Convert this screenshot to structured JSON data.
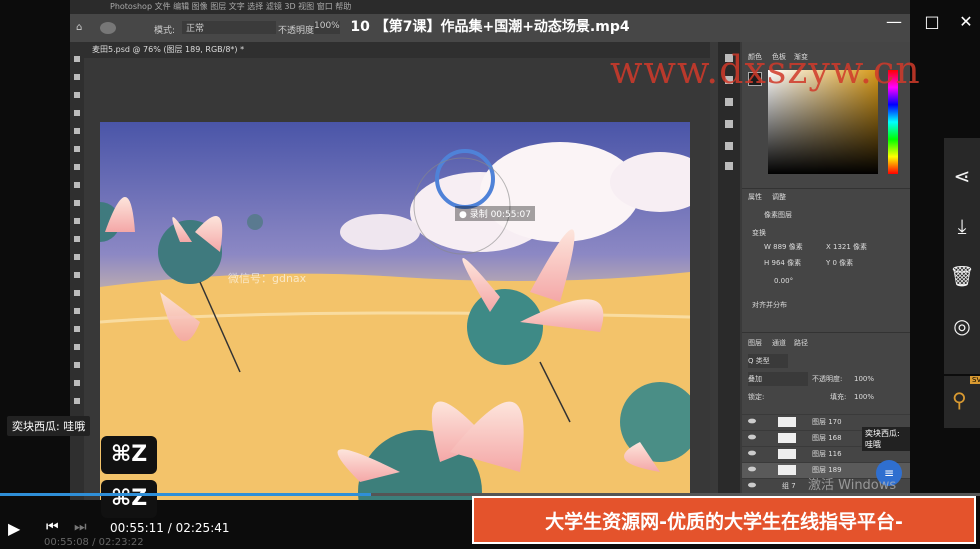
{
  "video": {
    "title": "10 【第7课】作品集+国潮+动态场景.mp4",
    "watermark_top": "www.dxszyw.cn",
    "banner": "大学生资源网-优质的大学生在线指导平台-www.dxszyw.cn",
    "current_time": "00:55:11",
    "duration": "02:25:41",
    "time_separator": "/",
    "progress": 0.379,
    "embedded_time": "00:55:08 / 02:23:22",
    "windows_watermark": "激活 Windows",
    "danmaku_left": "奕块西瓜: 哇哦",
    "danmaku_right": "奕块西瓜: 哇哦",
    "canvas_watermark": "微信号：gdnax",
    "rec_badge": "● 录制 00:55:07"
  },
  "window_controls": {
    "minimize": "—",
    "maximize": "□",
    "close": "✕"
  },
  "keys": [
    "⌘Z",
    "⌘Z"
  ],
  "sidebar_icons": [
    "share-icon",
    "download-icon",
    "trash-icon",
    "settings-icon",
    "pin-icon"
  ],
  "sidebar_badge": "SV",
  "photoshop": {
    "menu": "Photoshop  文件  编辑  图像  图层  文字  选择  滤镜  3D  视图  窗口  帮助",
    "mode_label": "模式:",
    "mode_value": "正常",
    "opacity_label": "不透明度:",
    "opacity_value": "100%",
    "doc_tab": "麦田5.psd @ 76% (图层 189, RGB/8*) *",
    "color_tabs": [
      "颜色",
      "色板",
      "渐变"
    ],
    "props_tabs": [
      "属性",
      "调整"
    ],
    "props_type": "像素图层",
    "transform_label": "变换",
    "w": "W  889 像素",
    "x": "X  1321 像素",
    "h": "H  964 像素",
    "y": "Y  0 像素",
    "angle": "0.00°",
    "align_label": "对齐并分布",
    "layer_tabs": [
      "图层",
      "通道",
      "路径"
    ],
    "layer_kind": "Q 类型",
    "blend": "叠加",
    "layer_opacity_label": "不透明度:",
    "layer_opacity": "100%",
    "lock_label": "锁定:",
    "fill_label": "填充:",
    "fill": "100%",
    "layers": [
      "图层 170",
      "图层 168",
      "图层 116",
      "图层 189",
      "组 7"
    ]
  },
  "colors": {
    "accent": "#2f8fd8",
    "banner": "#e4532c",
    "watermark": "#d13a2a"
  }
}
